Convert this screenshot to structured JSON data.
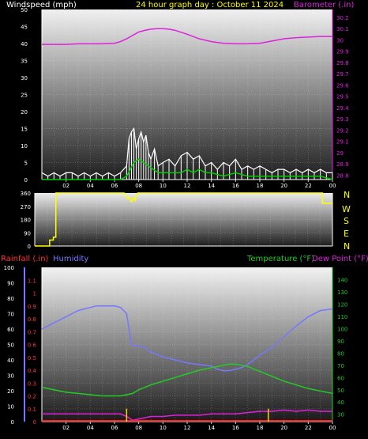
{
  "header": {
    "left_label": "Windspeed (mph)",
    "title": "24 hour graph day : October 11 2024",
    "right_label": "Barometer (.in)"
  },
  "direction_labels": [
    "N",
    "W",
    "S",
    "E",
    "N"
  ],
  "bottom_header": {
    "rain_label": "Rainfall (.in)",
    "humidity_label": "Humidity",
    "temp_label": "Temperature (°F)",
    "dew_label": "Dew Point (°F)"
  },
  "colors": {
    "wind": "#ffffff",
    "wind_avg": "#00cc00",
    "barometer": "#dd22dd",
    "direction": "#ffff00",
    "humidity": "#7777ff",
    "temperature": "#22cc22",
    "dewpoint": "#dd22dd",
    "rainfall": "#ff2222",
    "rain_rate": "#ffcc00",
    "title": "#ffff00"
  },
  "chart_data": [
    {
      "type": "line",
      "name": "wind-barometer",
      "x_ticks": [
        "02",
        "04",
        "06",
        "08",
        "10",
        "12",
        "14",
        "16",
        "18",
        "20",
        "22",
        "00"
      ],
      "xlim": [
        0,
        24
      ],
      "y_left_ticks": [
        "0",
        "5",
        "10",
        "15",
        "20",
        "25",
        "30",
        "35",
        "40",
        "45",
        "50"
      ],
      "ylim_left": [
        0,
        50
      ],
      "y_right_ticks": [
        "28.8",
        "28.9",
        "29",
        "29.1",
        "29.2",
        "29.3",
        "29.4",
        "29.5",
        "29.6",
        "29.7",
        "29.8",
        "29.9",
        "30",
        "30.1",
        "30.2"
      ],
      "ylim_right": [
        28.76,
        30.27
      ],
      "series": [
        {
          "key": "gust",
          "x": [
            0,
            0.5,
            1,
            1.5,
            2,
            2.5,
            3,
            3.5,
            4,
            4.5,
            5,
            5.5,
            6,
            6.5,
            7,
            7.2,
            7.4,
            7.6,
            7.8,
            8,
            8.2,
            8.4,
            8.6,
            8.8,
            9,
            9.3,
            9.6,
            10,
            10.5,
            11,
            11.5,
            12,
            12.5,
            13,
            13.5,
            14,
            14.5,
            15,
            15.5,
            16,
            16.5,
            17,
            17.5,
            18,
            18.5,
            19,
            19.5,
            20,
            20.5,
            21,
            21.5,
            22,
            22.5,
            23,
            23.5,
            24
          ],
          "values": [
            2,
            1,
            2,
            1,
            2,
            2,
            1,
            2,
            1,
            2,
            1,
            2,
            1,
            2,
            4,
            12,
            14,
            15,
            9,
            12,
            14,
            11,
            13,
            8,
            6,
            9,
            4,
            5,
            6,
            4,
            7,
            8,
            6,
            7,
            4,
            5,
            3,
            5,
            4,
            6,
            3,
            4,
            3,
            4,
            3,
            2,
            3,
            3,
            2,
            3,
            2,
            3,
            2,
            3,
            2,
            2
          ]
        },
        {
          "key": "average",
          "x": [
            0,
            1,
            2,
            3,
            4,
            5,
            6,
            6.5,
            7,
            7.3,
            7.6,
            8,
            8.4,
            8.8,
            9.2,
            9.6,
            10,
            10.5,
            11,
            11.5,
            12,
            12.5,
            13,
            13.5,
            14,
            15,
            16,
            17,
            18,
            19,
            20,
            21,
            22,
            23,
            24
          ],
          "values": [
            0,
            0,
            0,
            0,
            0,
            0,
            0,
            0,
            1,
            3,
            5,
            6,
            5,
            4,
            3,
            2,
            2,
            2,
            2,
            2,
            3,
            2,
            3,
            2,
            2,
            1,
            2,
            1,
            1,
            1,
            1,
            1,
            1,
            1,
            0
          ]
        },
        {
          "key": "barometer",
          "x": [
            0,
            1,
            2,
            3,
            4,
            5,
            6,
            6.5,
            7,
            7.5,
            8,
            8.5,
            9,
            9.5,
            10,
            10.5,
            11,
            12,
            13,
            14,
            15,
            16,
            16.5,
            17,
            18,
            19,
            20,
            21,
            22,
            23,
            24
          ],
          "values": [
            29.96,
            29.96,
            29.96,
            29.965,
            29.965,
            29.965,
            29.97,
            29.985,
            30.01,
            30.04,
            30.07,
            30.085,
            30.095,
            30.1,
            30.1,
            30.095,
            30.085,
            30.05,
            30.01,
            29.985,
            29.97,
            29.965,
            29.965,
            29.965,
            29.97,
            29.99,
            30.01,
            30.02,
            30.025,
            30.03,
            30.03
          ]
        }
      ]
    },
    {
      "type": "line",
      "name": "wind-direction",
      "x_ticks": [
        "02",
        "04",
        "06",
        "08",
        "10",
        "12",
        "14",
        "16",
        "18",
        "20",
        "22",
        "00"
      ],
      "xlim": [
        0,
        24
      ],
      "y_ticks": [
        "0",
        "90",
        "180",
        "270",
        "360"
      ],
      "ylim": [
        0,
        360
      ],
      "series": [
        {
          "key": "direction",
          "x": [
            0,
            1.2,
            1.2,
            1.5,
            1.5,
            1.7,
            1.7,
            7.2,
            7.3,
            7.5,
            7.6,
            7.8,
            8.0,
            8.1,
            8.2,
            8.3,
            8.5,
            23.2,
            23.2,
            24
          ],
          "values": [
            0,
            0,
            40,
            40,
            60,
            60,
            360,
            360,
            340,
            320,
            330,
            300,
            330,
            310,
            350,
            360,
            360,
            360,
            290,
            290
          ]
        }
      ]
    },
    {
      "type": "line",
      "name": "temperature-humidity-rain",
      "x_ticks": [
        "02",
        "04",
        "06",
        "08",
        "10",
        "12",
        "14",
        "16",
        "18",
        "20",
        "22",
        "00"
      ],
      "xlim": [
        0,
        24
      ],
      "y_humidity_ticks": [
        "0",
        "10",
        "20",
        "30",
        "40",
        "50",
        "60",
        "70",
        "80",
        "90",
        "100"
      ],
      "ylim_humidity": [
        0,
        100
      ],
      "y_rain_ticks": [
        "0",
        "0.1",
        "0.2",
        "0.3",
        "0.4",
        "0.5",
        "0.6",
        "0.7",
        "0.8",
        "0.9",
        "1",
        "1.1"
      ],
      "ylim_rain": [
        0,
        1.2
      ],
      "y_temp_ticks": [
        "30",
        "40",
        "50",
        "60",
        "70",
        "80",
        "90",
        "100",
        "110",
        "120",
        "130",
        "140"
      ],
      "ylim_temp": [
        24,
        150
      ],
      "series": [
        {
          "key": "humidity",
          "x": [
            0,
            0.5,
            1,
            1.5,
            2,
            2.5,
            3,
            3.5,
            4,
            4.5,
            5,
            5.5,
            6,
            6.5,
            7,
            7.2,
            7.4,
            7.6,
            8,
            8.5,
            9,
            10,
            11,
            12,
            13,
            14,
            14.5,
            15,
            15.5,
            16,
            16.5,
            17,
            17.5,
            18,
            19,
            20,
            21,
            22,
            23,
            24
          ],
          "values": [
            60,
            62,
            64,
            66,
            68,
            70,
            72,
            73,
            74,
            75,
            75,
            75,
            75,
            74,
            70,
            60,
            50,
            49,
            49,
            48,
            45,
            42,
            40,
            38,
            37,
            36,
            34,
            33,
            33,
            34,
            35,
            37,
            40,
            43,
            48,
            55,
            62,
            68,
            72,
            73
          ]
        },
        {
          "key": "temperature",
          "x": [
            0,
            1,
            2,
            3,
            4,
            5,
            6,
            6.5,
            7,
            7.5,
            8,
            8.5,
            9,
            10,
            11,
            12,
            13,
            14,
            14.5,
            15,
            15.5,
            16,
            16.5,
            17,
            17.5,
            18,
            19,
            20,
            21,
            22,
            23,
            24
          ],
          "values": [
            52,
            50,
            48,
            47,
            46,
            45,
            45,
            45,
            46,
            47,
            50,
            52,
            54,
            57,
            60,
            63,
            66,
            68,
            69,
            70,
            71,
            71,
            70,
            69,
            67,
            65,
            61,
            57,
            54,
            51,
            49,
            47
          ]
        },
        {
          "key": "dewpoint",
          "x": [
            0,
            1,
            2,
            3,
            4,
            5,
            6,
            6.5,
            7,
            7.5,
            8,
            8.5,
            9,
            10,
            11,
            12,
            13,
            14,
            15,
            16,
            17,
            18,
            19,
            20,
            21,
            22,
            23,
            24
          ],
          "values": [
            0.06,
            0.06,
            0.06,
            0.06,
            0.06,
            0.06,
            0.06,
            0.06,
            0.04,
            0.01,
            0.02,
            0.03,
            0.04,
            0.04,
            0.05,
            0.05,
            0.05,
            0.06,
            0.06,
            0.06,
            0.07,
            0.08,
            0.08,
            0.09,
            0.08,
            0.09,
            0.08,
            0.08
          ]
        },
        {
          "key": "rainfall",
          "x": [
            0,
            24
          ],
          "values": [
            0,
            0
          ]
        },
        {
          "key": "rain_rate",
          "x": [
            7.0,
            18.7
          ],
          "values": [
            0.1,
            0.1
          ]
        }
      ]
    }
  ]
}
